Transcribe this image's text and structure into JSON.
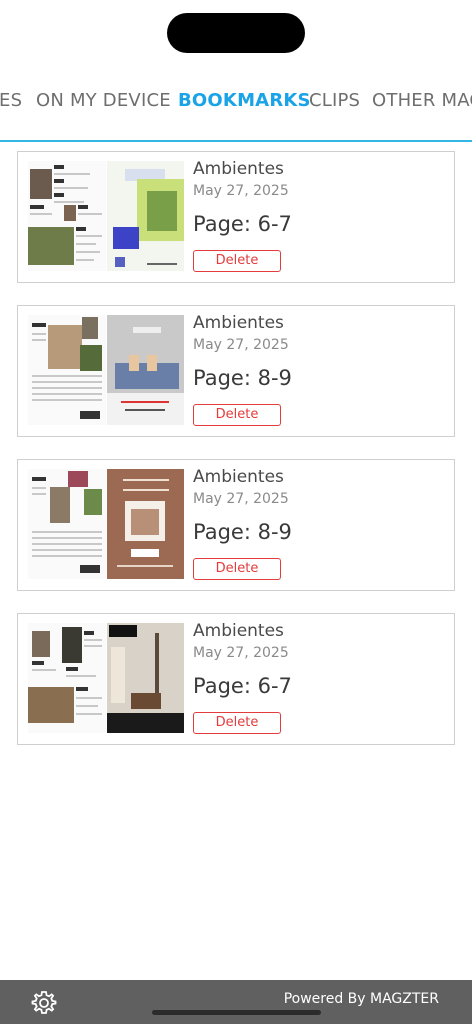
{
  "tabs": {
    "items": [
      {
        "label": "ES",
        "active": false
      },
      {
        "label": "ON MY DEVICE",
        "active": false
      },
      {
        "label": "BOOKMARKS",
        "active": true
      },
      {
        "label": "CLIPS",
        "active": false
      },
      {
        "label": "OTHER MAG",
        "active": false
      }
    ]
  },
  "bookmarks": [
    {
      "title": "Ambientes",
      "date": "May 27, 2025",
      "page": "Page: 6-7",
      "delete_label": "Delete"
    },
    {
      "title": "Ambientes",
      "date": "May 27, 2025",
      "page": "Page: 8-9",
      "delete_label": "Delete"
    },
    {
      "title": "Ambientes",
      "date": "May 27, 2025",
      "page": "Page: 8-9",
      "delete_label": "Delete"
    },
    {
      "title": "Ambientes",
      "date": "May 27, 2025",
      "page": "Page: 6-7",
      "delete_label": "Delete"
    }
  ],
  "footer": {
    "powered_by": "Powered By MAGZTER",
    "settings_icon": "gear-icon"
  },
  "colors": {
    "accent": "#1aa3e6",
    "delete": "#e23c3c",
    "footer_bg": "#606060"
  }
}
